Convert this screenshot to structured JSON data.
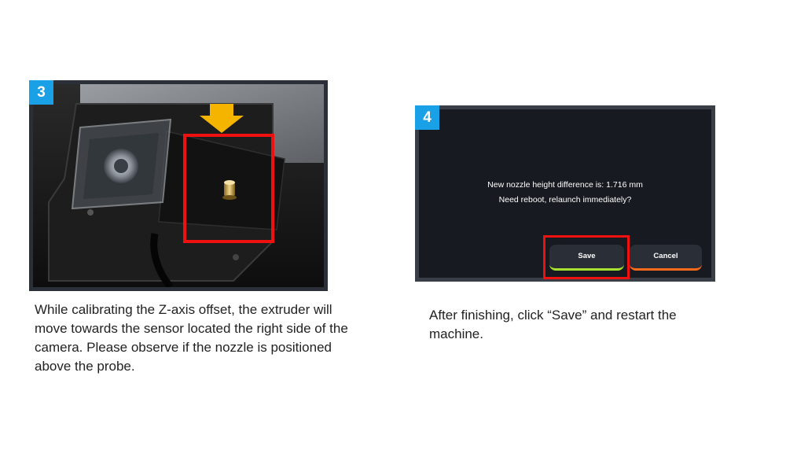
{
  "step3": {
    "badge": "3",
    "caption": "While calibrating the Z-axis offset, the extruder will move towards the sensor located the right side of the camera. Please observe if the nozzle is positioned above the probe."
  },
  "step4": {
    "badge": "4",
    "dialog": {
      "line1": "New nozzle height difference is: 1.716 mm",
      "line2": "Need reboot, relaunch immediately?",
      "save_label": "Save",
      "cancel_label": "Cancel"
    },
    "caption": "After finishing, click “Save” and restart the machine."
  },
  "colors": {
    "badge": "#1aa0e6",
    "highlight": "#ef1010",
    "arrow": "#f5b400",
    "save_accent": "#a6e22e",
    "cancel_accent": "#ff6a1a"
  }
}
